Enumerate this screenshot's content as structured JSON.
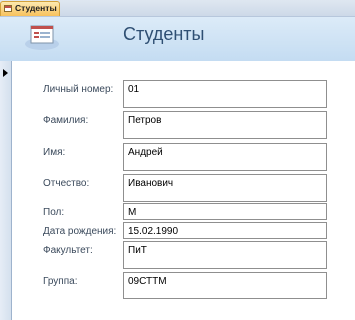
{
  "tab": {
    "label": "Студенты"
  },
  "header": {
    "title": "Студенты"
  },
  "fields": [
    {
      "label": "Личный номер:",
      "value": "01"
    },
    {
      "label": "Фамилия:",
      "value": "Петров"
    },
    {
      "label": "Имя:",
      "value": "Андрей"
    },
    {
      "label": "Отчество:",
      "value": "Иванович"
    },
    {
      "label": "Пол:",
      "value": "М"
    },
    {
      "label": "Дата рождения:",
      "value": "15.02.1990"
    },
    {
      "label": "Факультет:",
      "value": "ПиТ"
    },
    {
      "label": "Группа:",
      "value": "09СТТМ"
    }
  ],
  "colors": {
    "tab": "#f7c15c",
    "header": "#c4dcf2",
    "title": "#2f4f73"
  }
}
